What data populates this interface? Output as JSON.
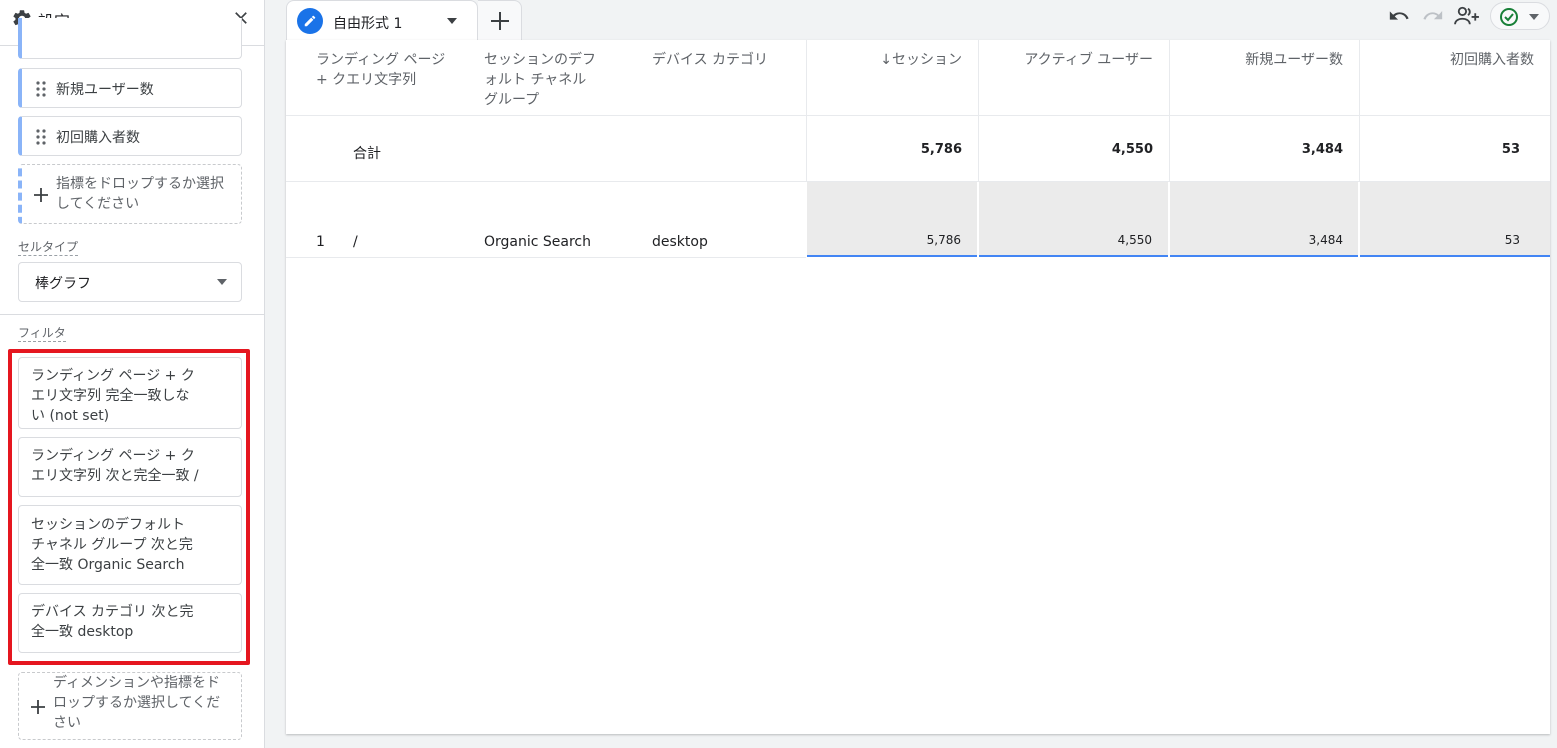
{
  "sidebar": {
    "title": "設定",
    "metrics": [
      {
        "label": "新規ユーザー数"
      },
      {
        "label": "初回購入者数"
      }
    ],
    "metric_drop_line1": "指標をドロップするか選択",
    "metric_drop_line2": "してください",
    "cell_type_label": "セルタイプ",
    "cell_type_value": "棒グラフ",
    "filter_label": "フィルタ",
    "filters": [
      {
        "line1": "ランディング ページ + ク",
        "line2": "エリ文字列 完全一致しな",
        "line3": "い (not set)"
      },
      {
        "line1": "ランディング ページ + ク",
        "line2": "エリ文字列 次と完全一致 /"
      },
      {
        "line1": "セッションのデフォルト",
        "line2": "チャネル グループ 次と完",
        "line3": "全一致 Organic Search"
      },
      {
        "line1": "デバイス カテゴリ 次と完",
        "line2": "全一致 desktop"
      }
    ],
    "filter_drop_line1": "ディメンションや指標をド",
    "filter_drop_line2": "ロップするか選択してくだ",
    "filter_drop_line3": "さい"
  },
  "tabs": [
    {
      "label": "自由形式 1"
    }
  ],
  "table": {
    "dim_headers": [
      {
        "line1": "ランディング ページ",
        "line2": "+ クエリ文字列"
      },
      {
        "line1": "セッションのデフ",
        "line2": "ォルト チャネル",
        "line3": "グループ"
      },
      {
        "line1": "デバイス カテゴリ"
      }
    ],
    "metric_headers": [
      "↓セッション",
      "アクティブ ユーザー",
      "新規ユーザー数",
      "初回購入者数"
    ],
    "totals_label": "合計",
    "totals": [
      "5,786",
      "4,550",
      "3,484",
      "53"
    ],
    "rows": [
      {
        "index": "1",
        "landing_page": "/",
        "channel": "Organic Search",
        "device": "desktop",
        "values": [
          "5,786",
          "4,550",
          "3,484",
          "53"
        ]
      }
    ]
  },
  "colors": {
    "accent": "#1a73e8",
    "highlight_border": "#e5161f",
    "metric_chip_bar": "#8ab4f8",
    "status_check": "#188038"
  },
  "icons": {
    "settings": "gear-icon",
    "close": "close-icon",
    "undo": "undo-icon",
    "redo": "redo-icon",
    "share": "share-users-icon",
    "status": "check-circle-icon"
  }
}
